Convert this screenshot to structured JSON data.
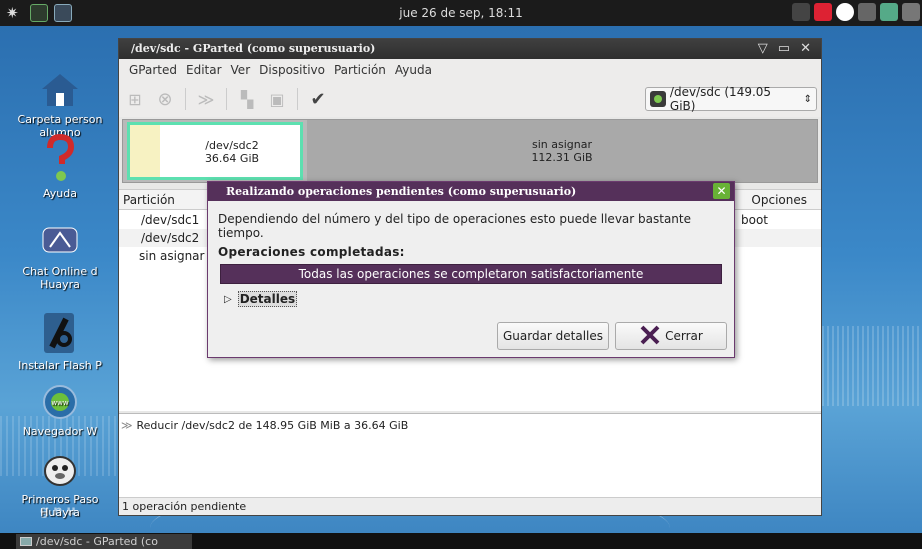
{
  "top_panel": {
    "clock": "jue 26 de sep, 18:11"
  },
  "desktop": {
    "icons": [
      {
        "label": "Carpeta person\nalumno",
        "icon": "home-folder-icon"
      },
      {
        "label": "Ayuda",
        "icon": "help-icon"
      },
      {
        "label": "Chat Online d\nHuayra",
        "icon": "chat-icon"
      },
      {
        "label": "Instalar Flash P",
        "icon": "flash-installer-icon"
      },
      {
        "label": "Navegador W",
        "icon": "web-browser-icon"
      },
      {
        "label": "Primeros Paso\nHuayra",
        "icon": "first-steps-icon"
      }
    ],
    "brand": "gnu"
  },
  "window": {
    "title": "/dev/sdc - GParted (como superusuario)",
    "menu": [
      "GParted",
      "Editar",
      "Ver",
      "Dispositivo",
      "Partición",
      "Ayuda"
    ],
    "device_selector": "/dev/sdc  (149.05 GiB)",
    "diskmap": {
      "partition": {
        "name": "/dev/sdc2",
        "size": "36.64 GiB"
      },
      "unallocated": {
        "name": "sin asignar",
        "size": "112.31 GiB"
      }
    },
    "table": {
      "col_partition": "Partición",
      "col_options": "Opciones",
      "rows": [
        {
          "name": "/dev/sdc1",
          "flag": "boot"
        },
        {
          "name": "/dev/sdc2",
          "flag": ""
        },
        {
          "name": "sin asignar",
          "flag": ""
        }
      ]
    },
    "pending_operation": "Reducir /dev/sdc2 de 148.95 GiB MiB a 36.64 GiB",
    "status": "1 operación pendiente"
  },
  "dialog": {
    "title": "Realizando operaciones pendientes (como superusuario)",
    "message": "Dependiendo del número y del tipo de operaciones esto puede llevar bastante tiempo.",
    "completed_label": "Operaciones completadas:",
    "progress_text": "Todas las operaciones se completaron satisfactoriamente",
    "progress_fraction": 1.0,
    "details_label": "Detalles",
    "save_button": "Guardar detalles",
    "close_button": "Cerrar",
    "colors": {
      "accent": "#55305a",
      "close_green": "#68b236",
      "close_x": "#4a1f52"
    }
  },
  "taskbar": {
    "task": "/dev/sdc - GParted (co"
  }
}
